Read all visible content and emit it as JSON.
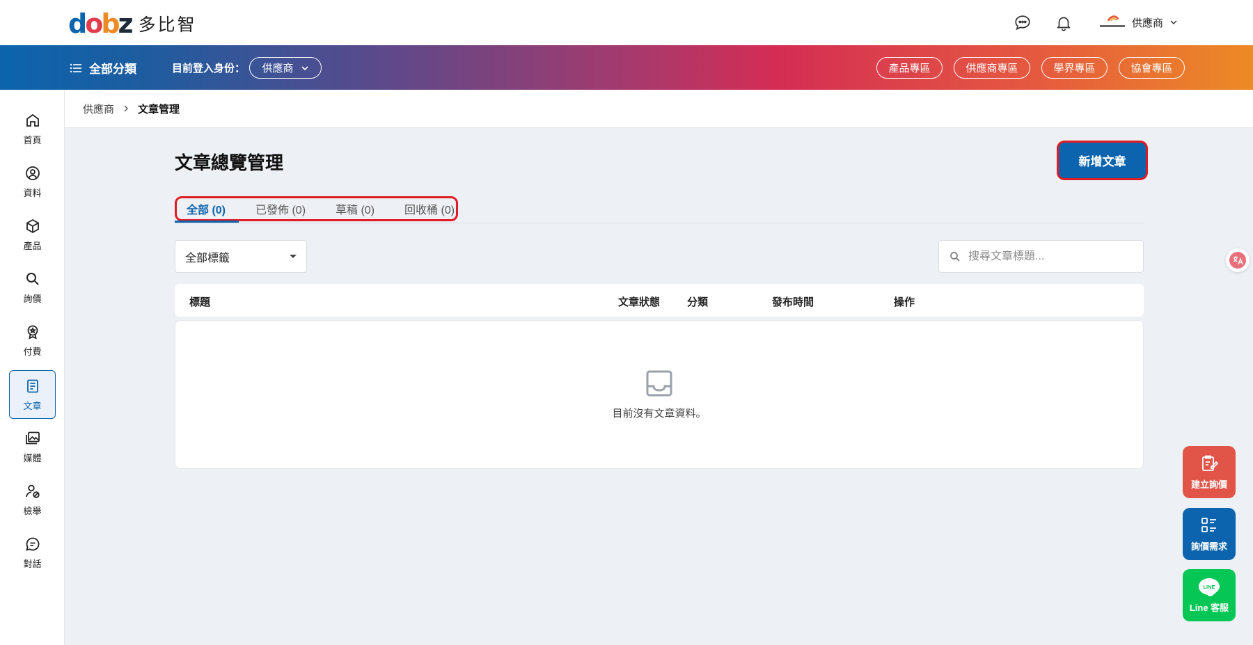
{
  "brand": {
    "logo_letters": [
      "d",
      "o",
      "b",
      "z"
    ],
    "logo_colors": [
      "#0b64ad",
      "#e33c4f",
      "#ec8a25",
      "#1e2a3a"
    ],
    "logo_text": "多比智"
  },
  "header": {
    "user_name": "供應商",
    "icons": [
      "chat-icon",
      "bell-icon",
      "chevron-down-icon"
    ]
  },
  "navbar": {
    "all_categories": "全部分類",
    "login_as_label": "目前登入身份：",
    "role_value": "供應商",
    "zones": [
      "產品專區",
      "供應商專區",
      "學界專區",
      "協會專區"
    ]
  },
  "sidebar": {
    "items": [
      {
        "label": "首頁",
        "icon": "home-icon"
      },
      {
        "label": "資料",
        "icon": "user-circle-icon"
      },
      {
        "label": "產品",
        "icon": "box-icon"
      },
      {
        "label": "詢價",
        "icon": "search-icon"
      },
      {
        "label": "付費",
        "icon": "badge-icon"
      },
      {
        "label": "文章",
        "icon": "document-icon",
        "active": true
      },
      {
        "label": "媒體",
        "icon": "gallery-icon"
      },
      {
        "label": "檢舉",
        "icon": "user-block-icon"
      },
      {
        "label": "對話",
        "icon": "message-icon"
      }
    ]
  },
  "breadcrumb": {
    "root": "供應商",
    "current": "文章管理"
  },
  "main": {
    "title": "文章總覽管理",
    "new_button": "新增文章",
    "tabs": [
      "全部 (0)",
      "已發佈 (0)",
      "草稿 (0)",
      "回收桶 (0)"
    ],
    "tag_filter": "全部標籤",
    "search_placeholder": "搜尋文章標題...",
    "columns": [
      "標題",
      "文章狀態",
      "分類",
      "發布時間",
      "操作"
    ],
    "empty_message": "目前沒有文章資料。"
  },
  "floating": {
    "create_inquiry": "建立詢價",
    "inquiry_needs": "詢價需求",
    "line_service": "Line 客服",
    "line_badge": "LINE"
  },
  "colors": {
    "primary": "#0b64ad",
    "highlight": "#e01c24",
    "inquiry_red": "#e05548",
    "line_green": "#06c755"
  }
}
